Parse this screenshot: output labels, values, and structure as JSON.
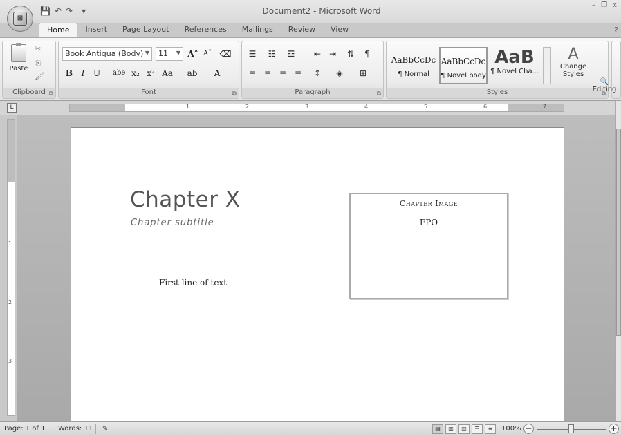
{
  "window": {
    "title": "Document2 - Microsoft Word"
  },
  "quick_access": {
    "save_icon": "save-icon",
    "undo_icon": "undo-icon",
    "redo_icon": "redo-icon"
  },
  "tabs": [
    {
      "label": "Home"
    },
    {
      "label": "Insert"
    },
    {
      "label": "Page Layout"
    },
    {
      "label": "References"
    },
    {
      "label": "Mailings"
    },
    {
      "label": "Review"
    },
    {
      "label": "View"
    }
  ],
  "ribbon": {
    "clipboard": {
      "group_label": "Clipboard",
      "paste_label": "Paste"
    },
    "font": {
      "group_label": "Font",
      "font_name": "Book Antiqua (Body)",
      "font_size": "11",
      "bold": "B",
      "italic": "I",
      "underline": "U",
      "strikethrough": "abe",
      "subscript": "x₂",
      "superscript": "x²",
      "change_case": "Aa",
      "grow": "A˄",
      "shrink": "A˅"
    },
    "paragraph": {
      "group_label": "Paragraph"
    },
    "styles": {
      "group_label": "Styles",
      "items": [
        {
          "sample": "AaBbCcDc",
          "name": "¶ Normal"
        },
        {
          "sample": "AaBbCcDc",
          "name": "¶ Novel body"
        },
        {
          "sample": "AaB",
          "name": "¶ Novel Cha..."
        }
      ],
      "change_styles_label": "Change Styles"
    },
    "editing": {
      "label": "Editing"
    }
  },
  "ruler": {
    "h_numbers": [
      "1",
      "2",
      "3",
      "4",
      "5",
      "6",
      "7"
    ],
    "v_numbers": [
      "1",
      "2",
      "3"
    ]
  },
  "document": {
    "chapter_title": "Chapter X",
    "chapter_subtitle": "Chapter subtitle",
    "first_line": "First line of text",
    "image_caption": "Chapter Image",
    "image_placeholder": "FPO"
  },
  "status": {
    "page": "Page: 1 of 1",
    "words": "Words: 11",
    "zoom": "100%"
  }
}
